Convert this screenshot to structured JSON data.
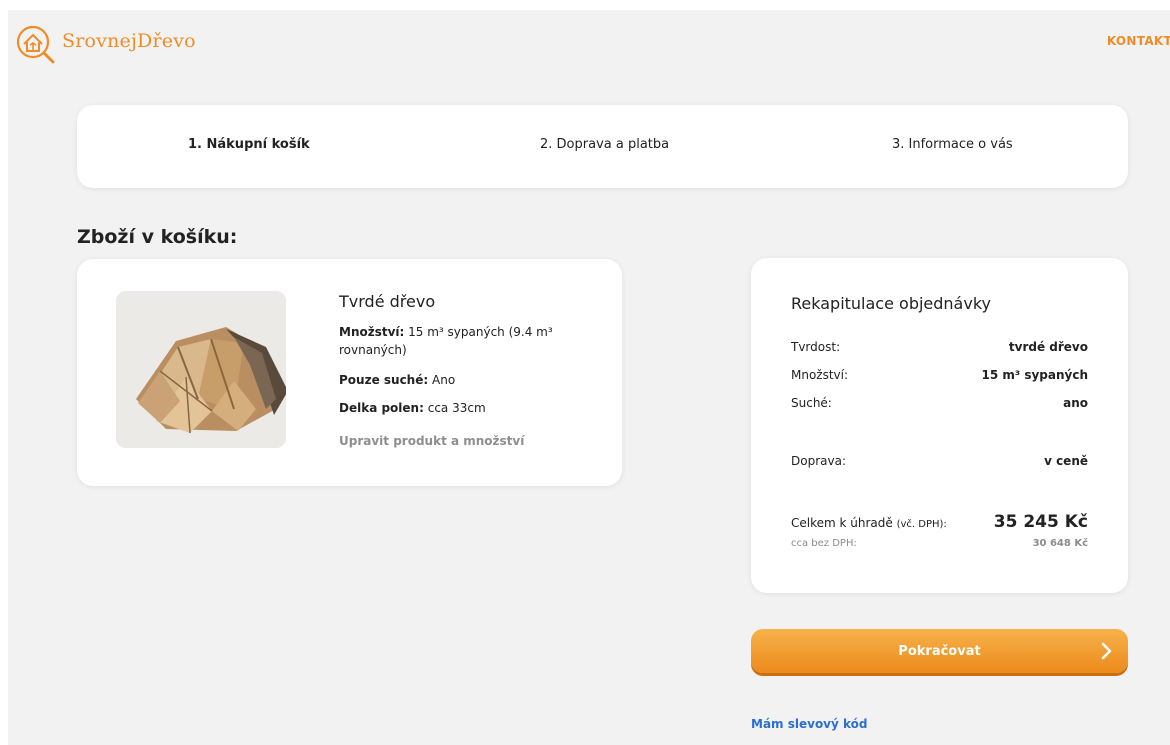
{
  "header": {
    "brand": "SrovnejDřevo",
    "nav_contact": "KONTAKT"
  },
  "steps": [
    {
      "label": "1. Nákupní košík",
      "active": true
    },
    {
      "label": "2. Doprava a platba",
      "active": false
    },
    {
      "label": "3. Informace o vás",
      "active": false
    }
  ],
  "cart": {
    "section_title": "Zboží v košíku:",
    "product": {
      "name": "Tvrdé dřevo",
      "quantity_label": "Množství:",
      "quantity_value": "15 m³ sypaných (9.4 m³ rovnaných)",
      "dry_label": "Pouze suché:",
      "dry_value": "Ano",
      "length_label": "Delka polen:",
      "length_value": "cca 33cm",
      "edit_link": "Upravit produkt a množství"
    }
  },
  "summary": {
    "title": "Rekapitulace objednávky",
    "hardness_label": "Tvrdost:",
    "hardness_value": "tvrdé dřevo",
    "quantity_label": "Množství:",
    "quantity_value": "15 m³ sypaných",
    "dry_label": "Suché:",
    "dry_value": "ano",
    "shipping_label": "Doprava:",
    "shipping_value": "v ceně",
    "total_label": "Celkem k úhradě",
    "total_label_note": "(vč. DPH):",
    "total_value": "35 245 Kč",
    "net_label": "cca bez DPH:",
    "net_value": "30 648 Kč"
  },
  "actions": {
    "continue_label": "Pokračovat",
    "discount_link": "Mám slevový kód"
  },
  "colors": {
    "accent": "#f08c28",
    "link": "#2b6fd1",
    "background": "#f2f2f2"
  },
  "icons": [
    "house-logo-icon",
    "chevron-right-icon"
  ]
}
